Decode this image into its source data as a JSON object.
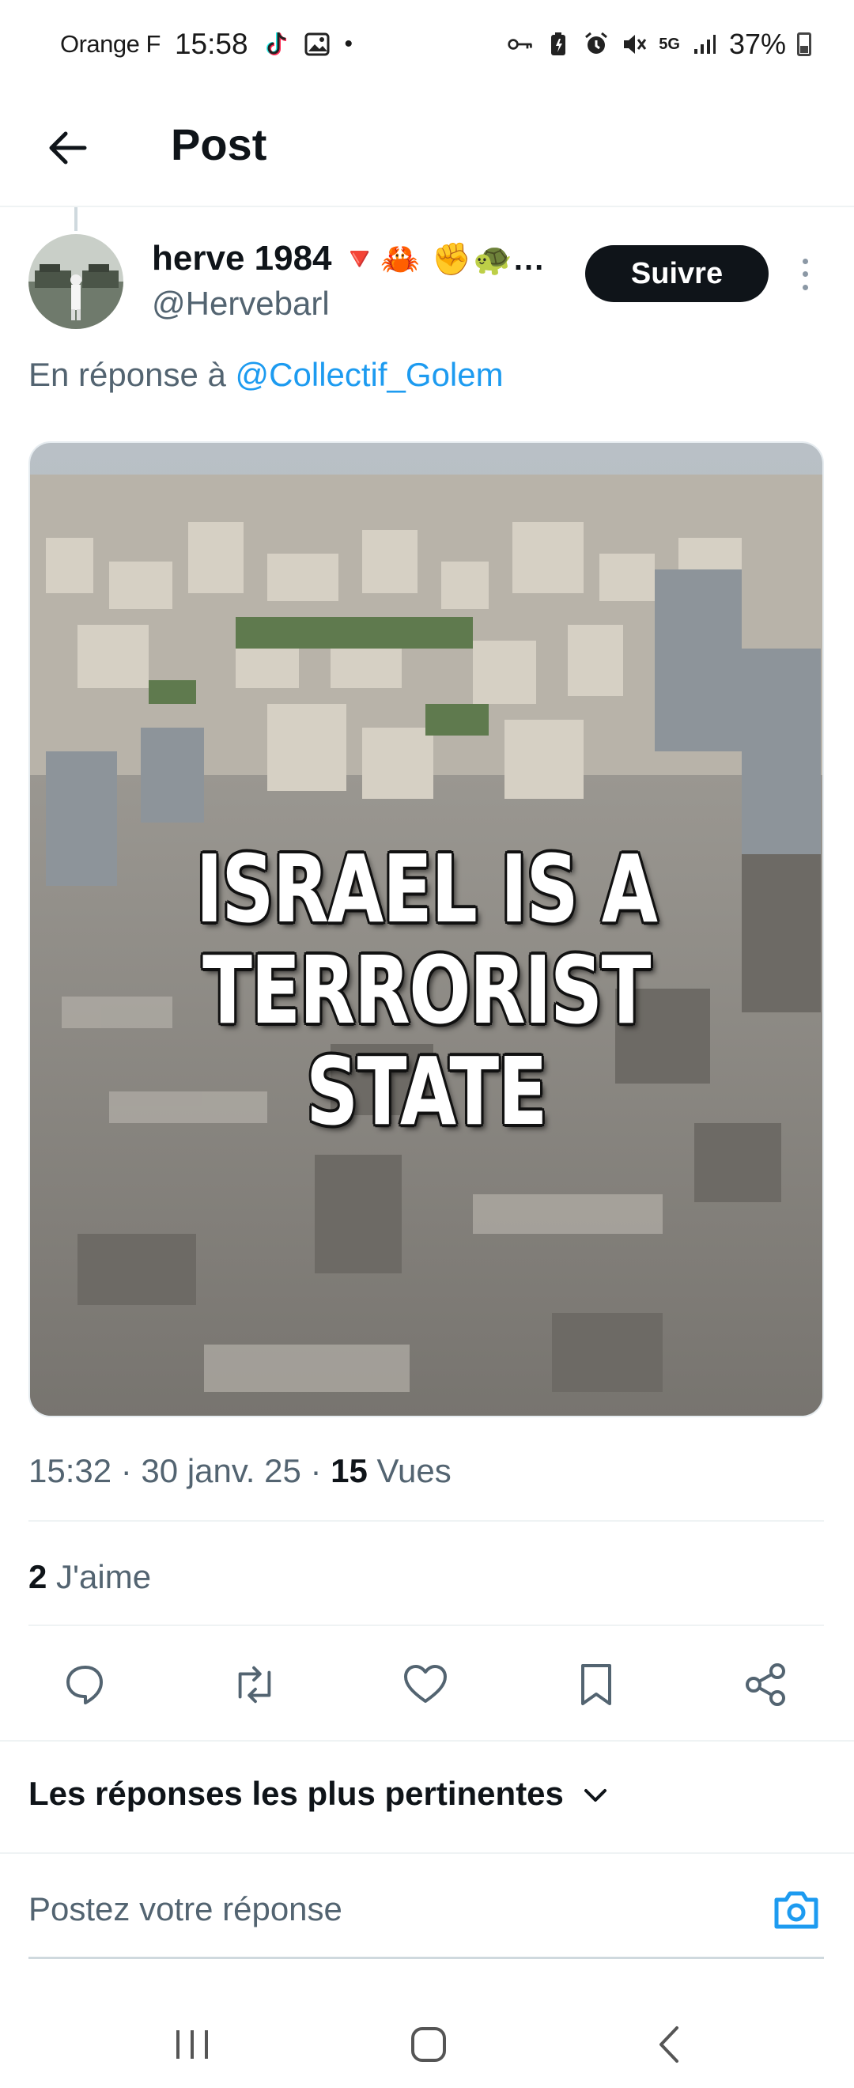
{
  "status_bar": {
    "carrier": "Orange F",
    "time": "15:58",
    "dot": "•",
    "network": "5G",
    "battery": "37%"
  },
  "header": {
    "title": "Post"
  },
  "post": {
    "author_name": "herve 1984",
    "author_emoji": "🔻🦀 ✊🐢...",
    "author_handle": "@Hervebarl",
    "follow_label": "Suivre",
    "reply_prefix": "En réponse à",
    "reply_to": "@Collectif_Golem",
    "image_text_line1": "ISRAEL IS A",
    "image_text_line2": "TERRORIST STATE",
    "timestamp": "15:32 · 30 janv. 25 ·",
    "views_count": "15",
    "views_label": "Vues",
    "likes_count": "2",
    "likes_label": "J'aime"
  },
  "actions": {
    "icons": [
      "reply-icon",
      "repost-icon",
      "like-icon",
      "bookmark-icon",
      "share-icon"
    ]
  },
  "replies": {
    "sort_label": "Les réponses les plus pertinentes",
    "compose_placeholder": "Postez votre réponse"
  },
  "colors": {
    "link": "#1d9bf0",
    "text": "#0f1419",
    "secondary": "#536471",
    "follow_bg": "#0f1419"
  }
}
